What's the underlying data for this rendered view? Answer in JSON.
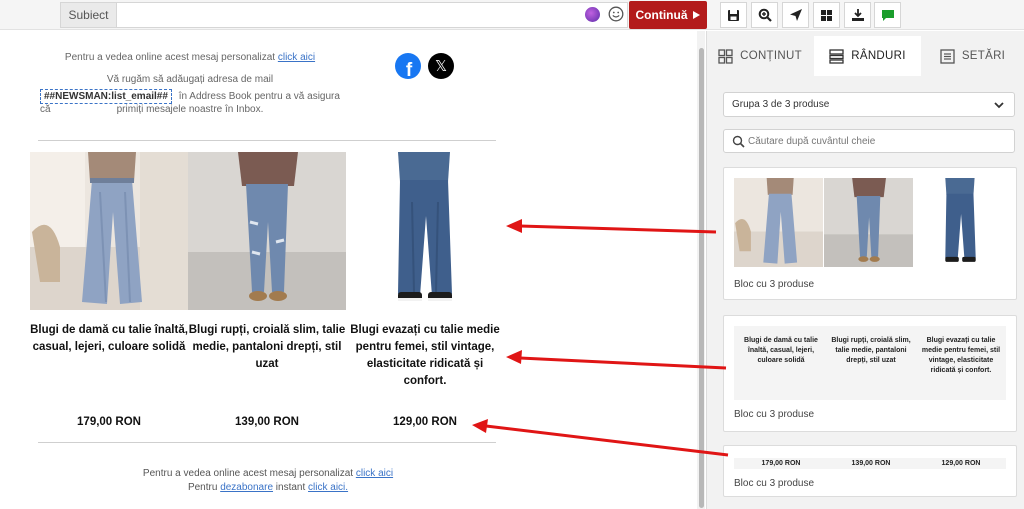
{
  "topbar": {
    "subject_label": "Subiect",
    "subject_value": "",
    "continue_label": "Continuă",
    "tools": [
      "save-icon",
      "zoom-icon",
      "send-icon",
      "grid-icon",
      "export-icon",
      "comment-icon"
    ]
  },
  "email": {
    "header_view_text": "Pentru a vedea online acest mesaj personalizat",
    "header_view_link": "click aici",
    "header_add_text": "Vă rugăm să adăugați adresa de mail",
    "email_tag": "##NEWSMAN:list_email##",
    "header_add_after": "în Address Book pentru a vă asigura că",
    "header_add_last": "primiți mesajele noastre în Inbox.",
    "social": [
      "facebook-icon",
      "x-icon"
    ],
    "products": [
      {
        "name": "Blugi de damă cu talie înaltă, casual, lejeri, culoare solidă",
        "price": "179,00 RON"
      },
      {
        "name": "Blugi rupți, croială slim, talie medie, pantaloni drepți, stil uzat",
        "price": "139,00 RON"
      },
      {
        "name": "Blugi evazați cu talie medie pentru femei, stil vintage, elasticitate ridicată și confort.",
        "price": "129,00 RON"
      }
    ],
    "footer_view_text": "Pentru a vedea online acest mesaj personalizat",
    "footer_view_link": "click aici",
    "footer_unsub_pre": "Pentru",
    "footer_unsub_link": "dezabonare",
    "footer_unsub_mid": "instant",
    "footer_unsub_link2": "click aici."
  },
  "panel": {
    "tabs": [
      {
        "label": "CONȚINUT",
        "icon": "content-icon"
      },
      {
        "label": "RÂNDURI",
        "icon": "rows-icon"
      },
      {
        "label": "SETĂRI",
        "icon": "settings-icon"
      }
    ],
    "active_tab": "RÂNDURI",
    "group_select": "Grupa 3 de 3 produse",
    "search_placeholder": "Căutare după cuvântul cheie",
    "cards": [
      {
        "label": "Bloc cu 3 produse"
      },
      {
        "label": "Bloc cu 3 produse"
      },
      {
        "label": "Bloc cu 3 produse"
      }
    ]
  },
  "colors": {
    "accent": "#b31b1b",
    "link": "#3a73c7",
    "arrow": "#e01515",
    "facebook": "#1877f2"
  }
}
